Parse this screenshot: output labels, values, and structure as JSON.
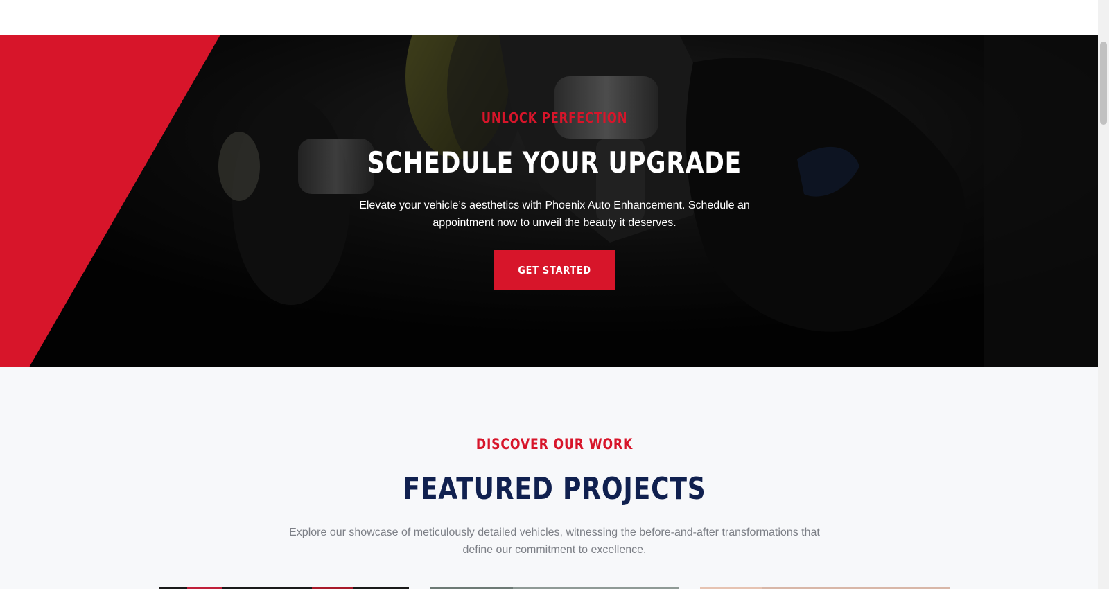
{
  "hero": {
    "eyebrow": "UNLOCK PERFECTION",
    "title": "SCHEDULE YOUR UPGRADE",
    "description": "Elevate your vehicle’s aesthetics with Phoenix Auto Enhancement. Schedule an appointment now to unveil the beauty it deserves.",
    "cta_label": "GET STARTED",
    "accent_color": "#d7152a",
    "background_color": "#0b0b0b"
  },
  "projects": {
    "eyebrow": "DISCOVER OUR WORK",
    "title": "FEATURED PROJECTS",
    "description": "Explore our showcase of meticulously detailed vehicles, witnessing the before-and-after transformations that define our commitment to excellence.",
    "title_color": "#10204f",
    "background_color": "#f7f8fa",
    "cards": [
      {
        "image": "project-photo-1"
      },
      {
        "image": "project-photo-2"
      },
      {
        "image": "project-photo-3"
      }
    ]
  }
}
